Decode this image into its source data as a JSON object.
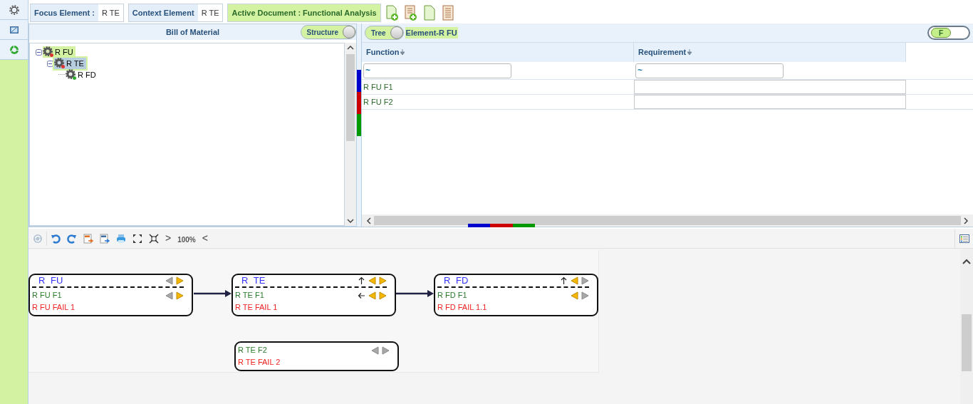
{
  "sidebar": {
    "items": [
      {
        "kind": "gear",
        "selected": false
      },
      {
        "kind": "monitor",
        "selected": false
      },
      {
        "kind": "cycle",
        "selected": false
      }
    ]
  },
  "topbar": {
    "focus": {
      "label": "Focus Element :",
      "value": "R TE"
    },
    "context": {
      "label": "Context Element",
      "value": "R TE"
    },
    "document": "Active Document : Functional Analysis",
    "actions": [
      {
        "kind": "doc-add"
      },
      {
        "kind": "list-add"
      },
      {
        "kind": "doc"
      },
      {
        "kind": "list"
      }
    ]
  },
  "bom": {
    "title": "Bill of Material",
    "toggle": {
      "label": "Structure",
      "on": true
    },
    "tree": [
      {
        "label": "R FU",
        "color": "#dd3333",
        "expanded": true,
        "selected": false,
        "in_path": true,
        "children": [
          {
            "label": "R TE",
            "color": "#dd3333",
            "expanded": true,
            "selected": true,
            "in_path": true,
            "children": [
              {
                "label": "R FD",
                "color": "#33aa33",
                "selected": false,
                "in_path": false
              }
            ]
          }
        ]
      }
    ]
  },
  "analysis": {
    "toggle": {
      "label": "Tree",
      "on": true
    },
    "element": "Element-R FU",
    "filter_toggle": {
      "label": "F",
      "on": true
    },
    "table": {
      "columns": [
        {
          "label": "Function",
          "filter": "~"
        },
        {
          "label": "Requirement",
          "filter": "~"
        }
      ],
      "rows": [
        {
          "function": "R FU F1"
        },
        {
          "function": "R FU F2"
        }
      ]
    }
  },
  "toolbar": {
    "items": [
      {
        "kind": "refresh",
        "disabled": true
      },
      {
        "kind": "undo",
        "disabled": false
      },
      {
        "kind": "redo",
        "disabled": false
      },
      {
        "kind": "export-svg",
        "disabled": false
      },
      {
        "kind": "export-png",
        "disabled": false
      },
      {
        "kind": "print",
        "disabled": false
      },
      {
        "kind": "expand",
        "disabled": false
      },
      {
        "kind": "fit",
        "disabled": false
      },
      {
        "kind": "next",
        "text": ">"
      },
      {
        "kind": "zoom",
        "text": "100%"
      },
      {
        "kind": "prev",
        "text": "<"
      }
    ]
  },
  "diagram": {
    "nodes": [
      {
        "title": "R FU",
        "title_nav": [
          {
            "kind": "left",
            "active": false
          },
          {
            "kind": "right",
            "active": true
          }
        ],
        "function": "R FU F1",
        "failure": "R FU FAIL 1",
        "nav": [
          {
            "kind": "left",
            "active": false
          },
          {
            "kind": "right",
            "active": true
          }
        ]
      },
      {
        "title": "R TE",
        "title_nav": [
          {
            "kind": "up",
            "active": true
          },
          {
            "kind": "left",
            "active": true
          },
          {
            "kind": "right",
            "active": true
          }
        ],
        "function": "R TE F1",
        "failure": "R TE FAIL 1",
        "nav": [
          {
            "kind": "back",
            "active": true
          },
          {
            "kind": "left",
            "active": true
          },
          {
            "kind": "right",
            "active": true
          }
        ]
      },
      {
        "title": "R FD",
        "title_nav": [
          {
            "kind": "up",
            "active": true
          },
          {
            "kind": "left",
            "active": true
          },
          {
            "kind": "right",
            "active": false
          }
        ],
        "function": "R FD F1",
        "failure": "R FD FAIL 1.1",
        "nav": [
          {
            "kind": "left",
            "active": true
          },
          {
            "kind": "right",
            "active": false
          }
        ]
      },
      {
        "function": "R TE F2",
        "failure": "R TE FAIL 2",
        "nav": [
          {
            "kind": "left",
            "active": false
          },
          {
            "kind": "right",
            "active": false
          }
        ]
      }
    ]
  }
}
